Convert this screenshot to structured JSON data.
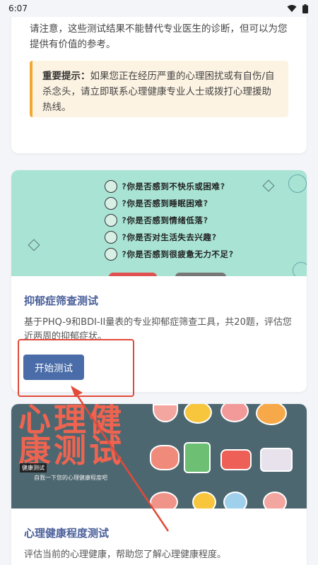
{
  "status_bar": {
    "time": "6:07"
  },
  "disclaimer": {
    "note": "请注意，这些测试结果不能替代专业医生的诊断，但可以为您提供有价值的参考。",
    "tip_bold": "重要提示：",
    "tip_text": "如果您正在经历严重的心理困扰或有自伤/自杀念头，请立即联系心理健康专业人士或拨打心理援助热线。"
  },
  "tests": [
    {
      "banner_questions": [
        "?你是否感到不快乐或困难?",
        "?你是否感到睡眠困难?",
        "?你是否感到情绪低落?",
        "?你是否对生活失去兴趣?",
        "?你是否感到很疲惫无力不足?"
      ],
      "title": "抑郁症筛查测试",
      "description": "基于PHQ-9和BDI-II量表的专业抑郁症筛查工具，共20题，评估您近两周的抑郁症状。",
      "button_label": "开始测试"
    },
    {
      "banner_title_line1": "心理健",
      "banner_title_line2": "康测试",
      "banner_tag": "健康测试",
      "banner_subtitle": "自我一下您的心理健康程度吧",
      "title": "心理健康程度测试",
      "description": "评估当前的心理健康，帮助您了解心理健康程度。"
    }
  ],
  "colors": {
    "accent_blue": "#4a6ca8",
    "title_blue": "#4a5f9a",
    "tip_orange": "#f0a830",
    "highlight_red": "#e24a3a",
    "banner_mint": "#a8e3d4",
    "banner_slate": "#4d6770"
  }
}
